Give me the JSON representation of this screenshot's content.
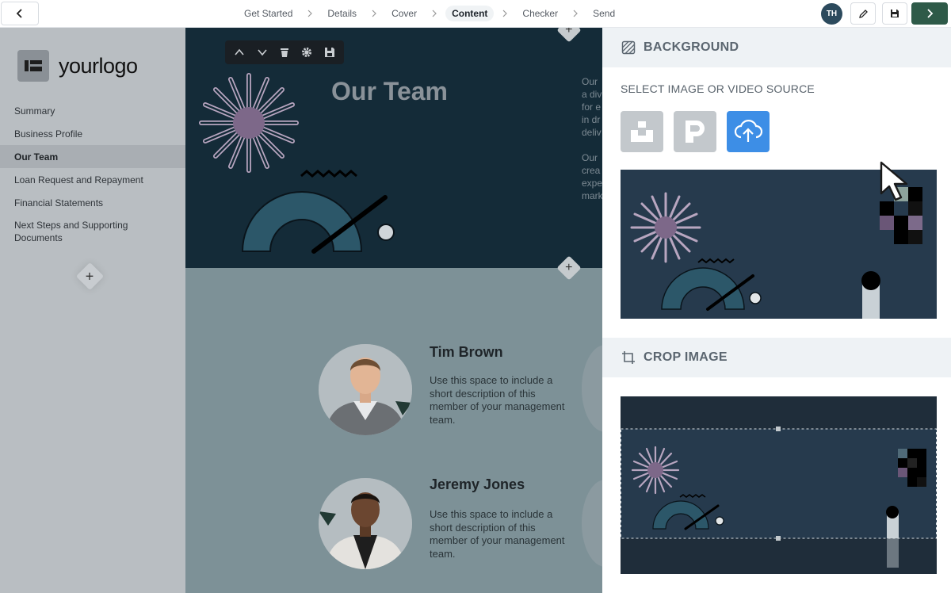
{
  "header": {
    "steps": [
      {
        "label": "Get Started"
      },
      {
        "label": "Details"
      },
      {
        "label": "Cover"
      },
      {
        "label": "Content"
      },
      {
        "label": "Checker"
      },
      {
        "label": "Send"
      }
    ],
    "active_step": "Content",
    "user_initials": "TH",
    "icons": [
      "chevron-left-icon",
      "pencil-icon",
      "save-icon",
      "chevron-right-icon"
    ]
  },
  "sidebar": {
    "logo_text": "yourlogo",
    "items": [
      {
        "label": "Summary"
      },
      {
        "label": "Business Profile"
      },
      {
        "label": "Our Team"
      },
      {
        "label": "Loan Request and Repayment"
      },
      {
        "label": "Financial Statements"
      },
      {
        "label": "Next Steps and Supporting Documents"
      }
    ],
    "active_item": "Our Team"
  },
  "canvas": {
    "title": "Our Team",
    "side_text": [
      "Our",
      "a div",
      "for e",
      "in dr",
      "deliv",
      "",
      "Our",
      "crea",
      "expe",
      "mark"
    ],
    "members": [
      {
        "name": "Tim Brown",
        "description": "Use this space to include a short description of this member of your management team."
      },
      {
        "name": "Jeremy Jones",
        "description": "Use this space to include a short description of this member of your management team."
      }
    ]
  },
  "panel": {
    "background_title": "BACKGROUND",
    "source_label": "SELECT IMAGE OR VIDEO SOURCE",
    "sources": [
      {
        "name": "unsplash",
        "color": "#c3c8cc"
      },
      {
        "name": "pexels",
        "color": "#c3c8cc"
      },
      {
        "name": "upload",
        "color": "#3d8ee6"
      }
    ],
    "crop_title": "CROP IMAGE"
  },
  "colors": {
    "accent_green": "#2e5a48",
    "hero_bg": "#142b38",
    "avatar_bg": "#2c4a5d",
    "upload_blue": "#3d8ee6"
  }
}
